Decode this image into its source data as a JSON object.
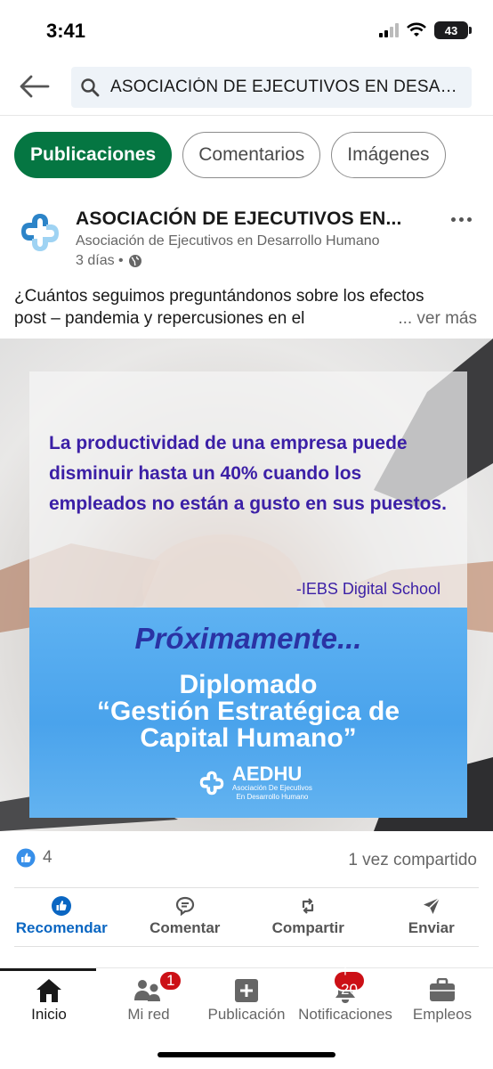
{
  "status_bar": {
    "time": "3:41",
    "battery": "43"
  },
  "header": {
    "search_text": "ASOCIACIÓN DE EJECUTIVOS EN DESAR..."
  },
  "filters": [
    {
      "label": "Publicaciones",
      "active": true
    },
    {
      "label": "Comentarios",
      "active": false
    },
    {
      "label": "Imágenes",
      "active": false
    }
  ],
  "post": {
    "author": "ASOCIACIÓN DE EJECUTIVOS EN...",
    "subtitle": "Asociación de Ejecutivos en Desarrollo Humano",
    "time": "3 días •",
    "text_line1": "¿Cuántos seguimos preguntándonos sobre los efectos",
    "text_line2": "post – pandemia y repercusiones en el",
    "see_more": "... ver más",
    "image": {
      "quote": "La productividad de una empresa puede disminuir hasta un 40% cuando los empleados no están a gusto en sus puestos.",
      "quote_source": "-IEBS Digital School",
      "soon": "Próximamente...",
      "title_line1": "Diplomado",
      "title_line2": "“Gestión Estratégica de",
      "title_line3": "Capital Humano”",
      "logo_big": "AEDHU",
      "logo_small_1": "Asociación De Ejecutivos",
      "logo_small_2": "En Desarrollo Humano"
    },
    "reaction_count": "4",
    "shares": "1 vez compartido"
  },
  "actions": [
    {
      "label": "Recomendar",
      "icon": "thumbs-up-icon",
      "active": true
    },
    {
      "label": "Comentar",
      "icon": "comment-icon",
      "active": false
    },
    {
      "label": "Compartir",
      "icon": "repost-icon",
      "active": false
    },
    {
      "label": "Enviar",
      "icon": "send-icon",
      "active": false
    }
  ],
  "bottom_nav": [
    {
      "label": "Inicio",
      "icon": "home-icon",
      "active": true
    },
    {
      "label": "Mi red",
      "icon": "network-icon",
      "badge": "1"
    },
    {
      "label": "Publicación",
      "icon": "plus-square-icon"
    },
    {
      "label": "Notificaciones",
      "icon": "bell-icon",
      "badge": "+ 20"
    },
    {
      "label": "Empleos",
      "icon": "briefcase-icon"
    }
  ],
  "colors": {
    "green": "#057642",
    "blue": "#0a66c2",
    "quote_purple": "#3b1fa6",
    "badge_red": "#cc1016"
  }
}
